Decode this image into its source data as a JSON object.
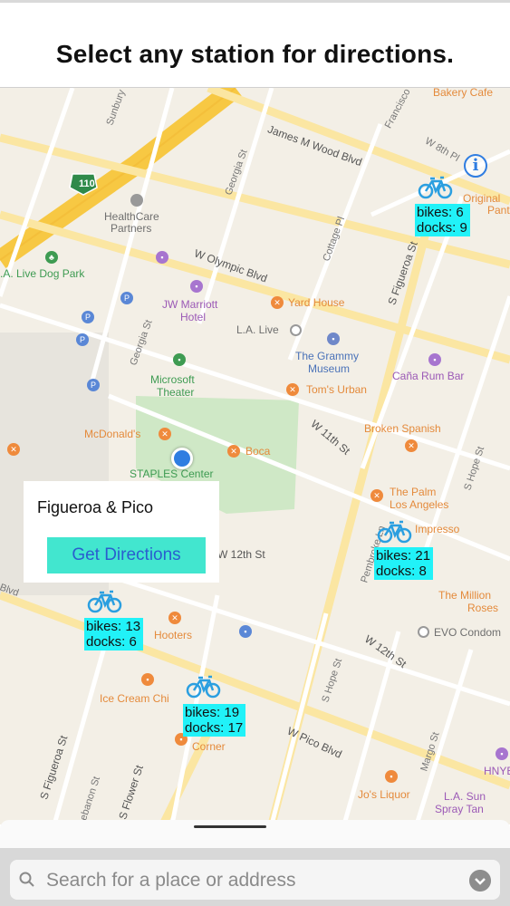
{
  "header": {
    "title": "Select any station for directions."
  },
  "map": {
    "labels": {
      "bakery": "Bakery Cafe",
      "original": "Original",
      "pantry": "Pantry",
      "healthcare1": "HealthCare",
      "healthcare2": "Partners",
      "dogpark": ".A. Live Dog Park",
      "jwmarriott1": "JW Marriott",
      "jwmarriott2": "Hotel",
      "yardhouse": "Yard House",
      "lalive": "L.A. Live",
      "grammy1": "The Grammy",
      "grammy2": "Museum",
      "microsoft1": "Microsoft",
      "microsoft2": "Theater",
      "tomsurban": "Tom's Urban",
      "canarum": "Caña Rum Bar",
      "mcdonalds": "McDonald's",
      "boca": "Boca",
      "staples": "STAPLES Center",
      "brokenspanish": "Broken Spanish",
      "palm1": "The Palm",
      "palm2": "Los Angeles",
      "impresso": "Impresso",
      "millions1": "The Million",
      "millions2": "Roses",
      "evo": "EVO Condom",
      "hooters": "Hooters",
      "icecream": "Ice Cream Chi",
      "corner": "Corner",
      "josliquor": "Jo's Liquor",
      "lasun1": "L.A. Sun",
      "lasun2": "Spray Tan",
      "hnyb": "HNYB",
      "freeway": "110"
    },
    "roads": {
      "jamesmwood": "James M Wood Blvd",
      "wolympic": "W Olympic Blvd",
      "sfigueroa_top": "S Figueroa St",
      "w11th": "W 11th St",
      "w12th": "W 12th St",
      "w12th_left": "W 12th St",
      "wpico": "W Pico Blvd",
      "sfigueroa_bottom": "S Figueroa St",
      "sflower": "S Flower St",
      "georgia1": "Georgia St",
      "georgia2": "Georgia St",
      "cottage": "Cottage Pl",
      "francisco": "Francisco St",
      "w8th": "W 8th Pl",
      "pembroke": "Pembroke Ln",
      "shope1": "S Hope St",
      "shope2": "S Hope St",
      "margo": "Margo St",
      "lebanon": "Lebanon St",
      "sunbury": "Sunbury",
      "blvd": "Blvd"
    }
  },
  "stations": [
    {
      "bikes_label": "bikes: 6",
      "docks_label": "docks: 9",
      "bikes": 6,
      "docks": 9
    },
    {
      "bikes_label": "bikes: 21",
      "docks_label": "docks: 8",
      "bikes": 21,
      "docks": 8
    },
    {
      "bikes_label": "bikes: 13",
      "docks_label": "docks: 6",
      "bikes": 13,
      "docks": 6
    },
    {
      "bikes_label": "bikes: 19",
      "docks_label": "docks: 17",
      "bikes": 19,
      "docks": 17
    }
  ],
  "callout": {
    "station_name": "Figueroa & Pico",
    "button_label": "Get Directions"
  },
  "info_button": {
    "glyph": "i"
  },
  "search": {
    "placeholder": "Search for a place or address"
  },
  "colors": {
    "station_label_bg": "#21f2f8",
    "button_bg": "#42e6cf",
    "button_text": "#2a5ecf",
    "user_location": "#2f7de1",
    "freeway": "#f7c843"
  }
}
